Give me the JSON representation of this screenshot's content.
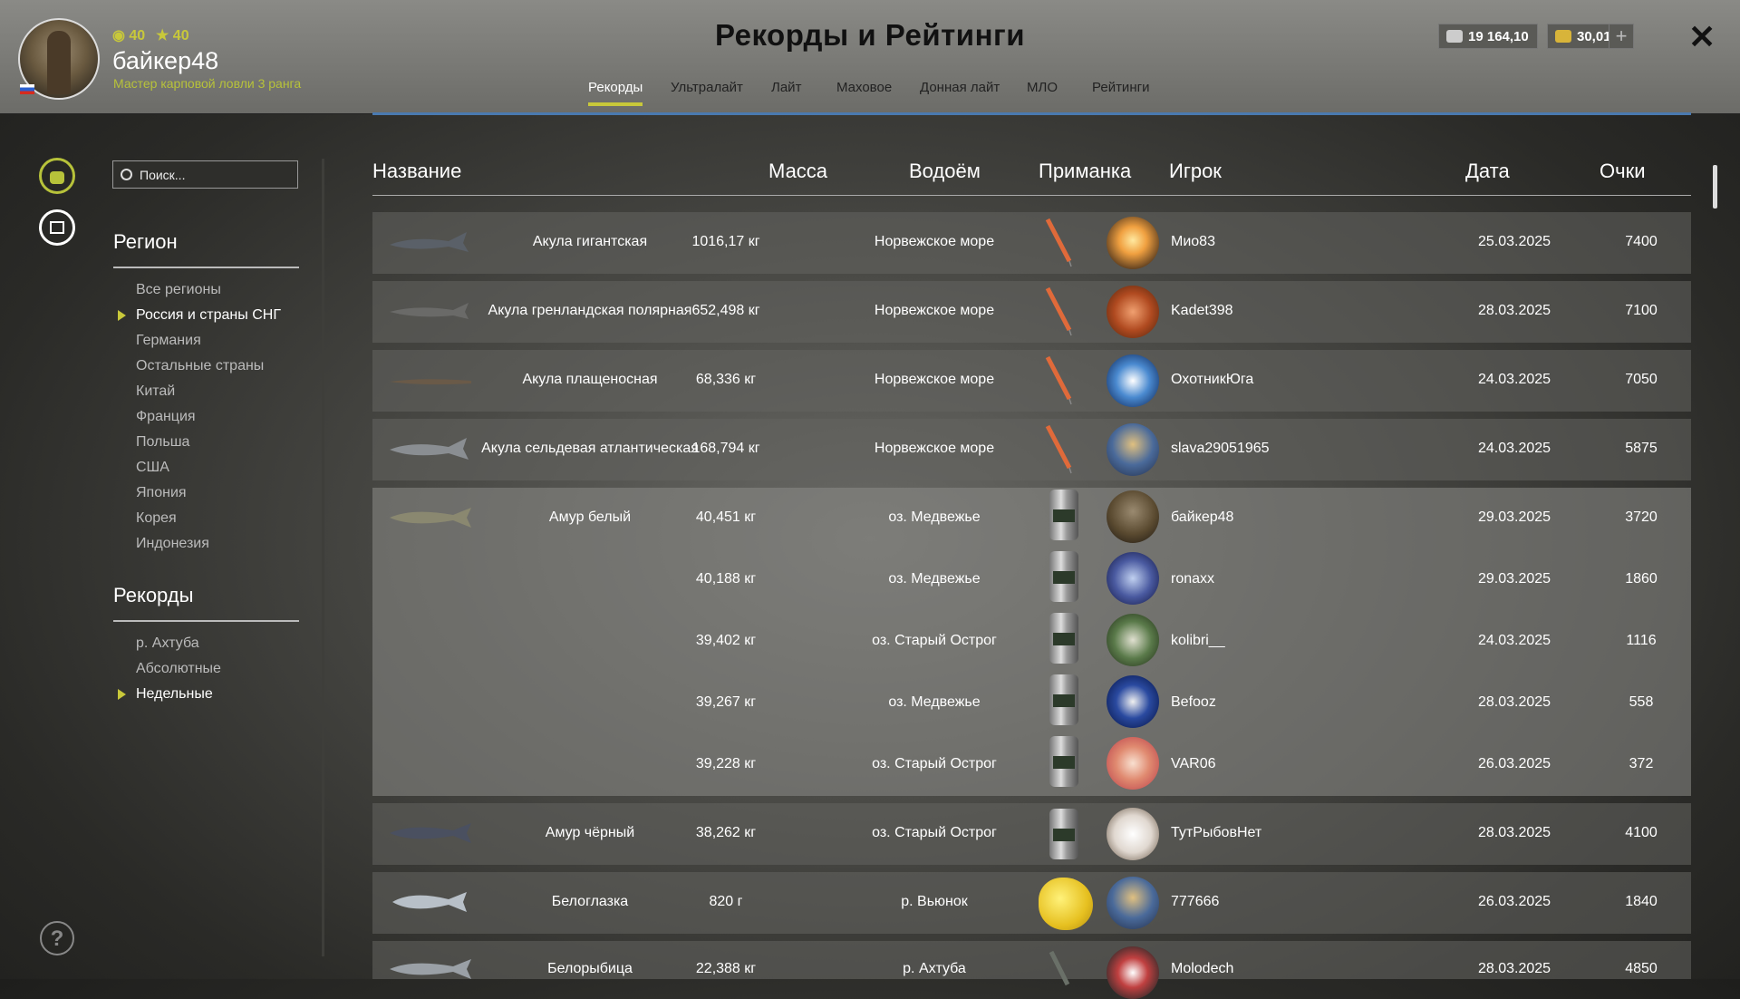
{
  "header": {
    "title": "Рекорды и Рейтинги",
    "player": {
      "name": "байкер48",
      "rank": "Мастер карповой ловли 3 ранга",
      "stat_level": "40",
      "stat_stars": "40"
    },
    "currency": {
      "silver": "19 164,10",
      "gold": "30,01"
    },
    "plus_label": "+",
    "close_label": "✕",
    "tabs": [
      {
        "label": "Рекорды",
        "active": true
      },
      {
        "label": "Ультралайт",
        "active": false
      },
      {
        "label": "Лайт",
        "active": false
      },
      {
        "label": "Маховое",
        "active": false
      },
      {
        "label": "Донная лайт",
        "active": false
      },
      {
        "label": "МЛО",
        "active": false
      },
      {
        "label": "Рейтинги",
        "active": false
      }
    ]
  },
  "sidebar": {
    "search_placeholder": "Поиск...",
    "region_title": "Регион",
    "regions": [
      "Все регионы",
      "Россия и страны СНГ",
      "Германия",
      "Остальные страны",
      "Китай",
      "Франция",
      "Польша",
      "США",
      "Япония",
      "Корея",
      "Индонезия"
    ],
    "region_active": 1,
    "records_title": "Рекорды",
    "records": [
      "р. Ахтуба",
      "Абсолютные",
      "Недельные"
    ],
    "records_active": 2,
    "help_label": "?"
  },
  "table": {
    "headers": {
      "name": "Название",
      "mass": "Масса",
      "water": "Водоём",
      "bait": "Приманка",
      "player": "Игрок",
      "date": "Дата",
      "points": "Очки"
    },
    "rows": [
      {
        "name": "Акула гигантская",
        "mass": "1016,17 кг",
        "water": "Норвежское море",
        "player": "Мио83",
        "date": "25.03.2025",
        "points": "7400"
      },
      {
        "name": "Акула гренландская полярная",
        "mass": "652,498 кг",
        "water": "Норвежское море",
        "player": "Kadet398",
        "date": "28.03.2025",
        "points": "7100"
      },
      {
        "name": "Акула плащеносная",
        "mass": "68,336 кг",
        "water": "Норвежское море",
        "player": "ОхотникЮга",
        "date": "24.03.2025",
        "points": "7050"
      },
      {
        "name": "Акула сельдевая атлантическая",
        "mass": "168,794 кг",
        "water": "Норвежское море",
        "player": "slava29051965",
        "date": "24.03.2025",
        "points": "5875"
      },
      {
        "name": "Амур белый",
        "mass": "40,451 кг",
        "water": "оз. Медвежье",
        "player": "байкер48",
        "date": "29.03.2025",
        "points": "3720"
      },
      {
        "name": "",
        "mass": "40,188 кг",
        "water": "оз. Медвежье",
        "player": "ronaxx",
        "date": "29.03.2025",
        "points": "1860"
      },
      {
        "name": "",
        "mass": "39,402 кг",
        "water": "оз. Старый Острог",
        "player": "kolibri__",
        "date": "24.03.2025",
        "points": "1116"
      },
      {
        "name": "",
        "mass": "39,267 кг",
        "water": "оз. Медвежье",
        "player": "Befooz",
        "date": "28.03.2025",
        "points": "558"
      },
      {
        "name": "",
        "mass": "39,228 кг",
        "water": "оз. Старый Острог",
        "player": "VAR06",
        "date": "26.03.2025",
        "points": "372"
      },
      {
        "name": "Амур чёрный",
        "mass": "38,262 кг",
        "water": "оз. Старый Острог",
        "player": "ТутРыбовНет",
        "date": "28.03.2025",
        "points": "4100"
      },
      {
        "name": "Белоглазка",
        "mass": "820 г",
        "water": "р. Вьюнок",
        "player": "777666",
        "date": "26.03.2025",
        "points": "1840"
      },
      {
        "name": "Белорыбица",
        "mass": "22,388 кг",
        "water": "р. Ахтуба",
        "player": "Molodech",
        "date": "28.03.2025",
        "points": "4850"
      }
    ]
  },
  "colors": {
    "accent_yellow": "#c8c83a",
    "accent_blue": "#4a7ab0"
  }
}
